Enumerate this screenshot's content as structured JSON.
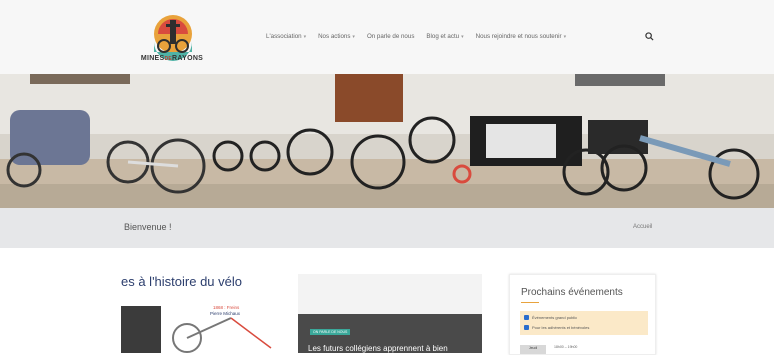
{
  "header": {
    "logo_text_left": "MINES",
    "logo_text_mid": "DE",
    "logo_text_right": "RAYONS",
    "nav": [
      {
        "label": "L'association",
        "dropdown": true
      },
      {
        "label": "Nos actions",
        "dropdown": true
      },
      {
        "label": "On parle de nous",
        "dropdown": false
      },
      {
        "label": "Blog et actu",
        "dropdown": true
      },
      {
        "label": "Nous rejoindre et nous soutenir",
        "dropdown": true
      }
    ],
    "search_icon": "search-icon"
  },
  "page": {
    "title": "Bienvenue !",
    "breadcrumb": "Accueil"
  },
  "cards": {
    "history": {
      "heading": "es à l'histoire du vélo",
      "note1": "1868 : Freins",
      "note2": "Pierre Michaux"
    },
    "news": {
      "tag": "ON PARLE DE NOUS",
      "caption": "Les futurs collégiens apprennent à bien"
    },
    "events": {
      "heading": "Prochains événements",
      "filters": [
        "Événements grand public",
        "Pour les adhérents et bénévoles"
      ],
      "date": "Jeudi",
      "time": "18h00 – 19h00"
    }
  },
  "colors": {
    "header_bg": "#f7f7f7",
    "title_bar_bg": "#e6e7e9",
    "accent": "#e8a33d",
    "tag": "#3aa89a",
    "heading_blue": "#2c3e6d"
  }
}
